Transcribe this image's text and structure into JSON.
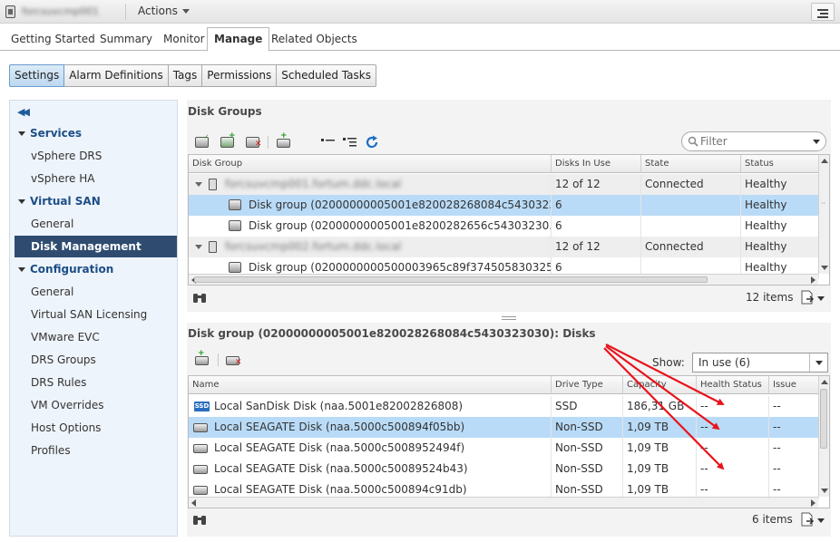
{
  "titlebar": {
    "host_name": "forcsuvcmp001",
    "actions_label": "Actions"
  },
  "main_tabs": [
    {
      "label": "Getting Started"
    },
    {
      "label": "Summary"
    },
    {
      "label": "Monitor"
    },
    {
      "label": "Manage"
    },
    {
      "label": "Related Objects"
    }
  ],
  "sub_tabs": [
    {
      "label": "Settings"
    },
    {
      "label": "Alarm Definitions"
    },
    {
      "label": "Tags"
    },
    {
      "label": "Permissions"
    },
    {
      "label": "Scheduled Tasks"
    }
  ],
  "sidebar": {
    "items": [
      {
        "label": "Services"
      },
      {
        "label": "vSphere DRS"
      },
      {
        "label": "vSphere HA"
      },
      {
        "label": "Virtual SAN"
      },
      {
        "label": "General"
      },
      {
        "label": "Disk Management"
      },
      {
        "label": "Configuration"
      },
      {
        "label": "General"
      },
      {
        "label": "Virtual SAN Licensing"
      },
      {
        "label": "VMware EVC"
      },
      {
        "label": "DRS Groups"
      },
      {
        "label": "DRS Rules"
      },
      {
        "label": "VM Overrides"
      },
      {
        "label": "Host Options"
      },
      {
        "label": "Profiles"
      }
    ]
  },
  "disk_groups": {
    "title": "Disk Groups",
    "filter_placeholder": "Filter",
    "columns": [
      "Disk Group",
      "Disks In Use",
      "State",
      "Status"
    ],
    "rows": [
      {
        "name": "forcsuvcmp001.fortum.ddc.local",
        "disks": "12 of 12",
        "state": "Connected",
        "status": "Healthy"
      },
      {
        "name": "Disk group (02000000005001e820028268084c5430323...",
        "disks": "6",
        "state": "",
        "status": "Healthy"
      },
      {
        "name": "Disk group (02000000005001e8200282656c54303230...",
        "disks": "6",
        "state": "",
        "status": "Healthy"
      },
      {
        "name": "forcsuvcmp002.fortum.ddc.local",
        "disks": "12 of 12",
        "state": "Connected",
        "status": "Healthy"
      },
      {
        "name": "Disk group (0200000000500003965c89f3745058303253...",
        "disks": "6",
        "state": "",
        "status": "Healthy"
      }
    ],
    "item_count": "12 items"
  },
  "disks": {
    "title": "Disk group (02000000005001e820028268084c5430323030): Disks",
    "show_label": "Show:",
    "show_value": "In use (6)",
    "columns": [
      "Name",
      "Drive Type",
      "Capacity",
      "Health Status",
      "Issue"
    ],
    "rows": [
      {
        "name": "Local SanDisk Disk (naa.5001e82002826808)",
        "type": "SSD",
        "capacity": "186,31 GB",
        "health": "--",
        "issue": "--",
        "ssd_label": "SSD"
      },
      {
        "name": "Local SEAGATE Disk (naa.5000c500894f05bb)",
        "type": "Non-SSD",
        "capacity": "1,09 TB",
        "health": "--",
        "issue": "--"
      },
      {
        "name": "Local SEAGATE Disk (naa.5000c5008952494f)",
        "type": "Non-SSD",
        "capacity": "1,09 TB",
        "health": "--",
        "issue": "--"
      },
      {
        "name": "Local SEAGATE Disk (naa.5000c50089524b43)",
        "type": "Non-SSD",
        "capacity": "1,09 TB",
        "health": "--",
        "issue": "--"
      },
      {
        "name": "Local SEAGATE Disk (naa.5000c500894c91db)",
        "type": "Non-SSD",
        "capacity": "1,09 TB",
        "health": "--",
        "issue": "--"
      }
    ],
    "item_count": "6 items"
  },
  "colors": {
    "selection": "#b9dbf7",
    "nav_selected": "#2f4c70",
    "section_text": "#1d4e86",
    "annotation_arrow": "#e8141c"
  }
}
